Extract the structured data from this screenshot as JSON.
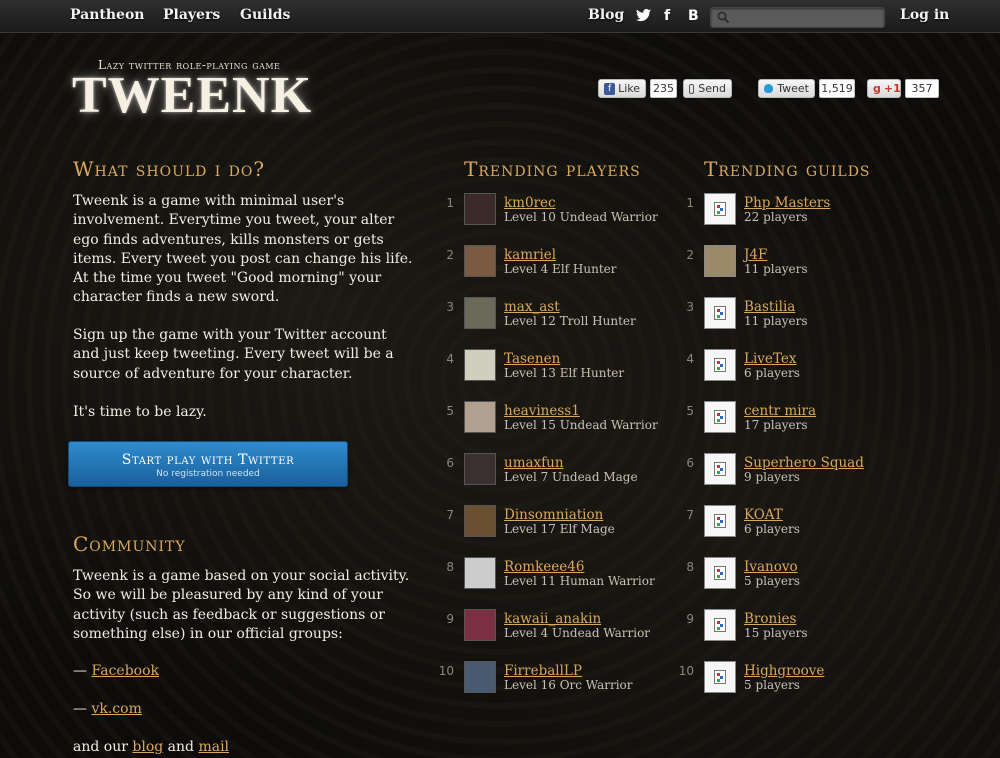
{
  "nav": {
    "pantheon": "Pantheon",
    "players": "Players",
    "guilds": "Guilds",
    "blog": "Blog",
    "login": "Log in",
    "search_placeholder": ""
  },
  "brand": {
    "tagline": "Lazy twitter role-playing game",
    "logo": "TWEENK"
  },
  "share": {
    "like_label": "Like",
    "like_count": "235",
    "send_label": "Send",
    "tweet_label": "Tweet",
    "tweet_count": "1,519",
    "gplus_label": "+1",
    "gplus_count": "357"
  },
  "intro": {
    "heading": "What should i do?",
    "p1": "Tweenk is a game with minimal user's involvement. Everytime you tweet, your alter ego finds adventures, kills monsters or gets items. Every tweet you post can change his life. At the time you tweet \"Good morning\" your character finds a new sword.",
    "p2": "Sign up the game with your Twitter account and just keep tweeting. Every tweet will be a source of adventure for your character.",
    "p3": "It's time to be lazy.",
    "cta_main": "Start play with Twitter",
    "cta_sub": "No registration needed"
  },
  "community": {
    "heading": "Community",
    "p1": "Tweenk is a game based on your social activity. So we will be pleasured by any kind of your activity (such as feedback or suggestions or something else) in our official groups:",
    "dash": "—",
    "facebook": "Facebook",
    "vk": "vk.com",
    "and_our": "and our",
    "blog": "blog",
    "and": "and",
    "mail": "mail"
  },
  "players": {
    "heading": "Trending players",
    "items": [
      {
        "rank": "1",
        "name": "km0rec",
        "sub": "Level 10 Undead Warrior"
      },
      {
        "rank": "2",
        "name": "kamriel",
        "sub": "Level 4 Elf Hunter"
      },
      {
        "rank": "3",
        "name": "max_ast",
        "sub": "Level 12 Troll Hunter"
      },
      {
        "rank": "4",
        "name": "Tasenen",
        "sub": "Level 13 Elf Hunter"
      },
      {
        "rank": "5",
        "name": "heaviness1",
        "sub": "Level 15 Undead Warrior"
      },
      {
        "rank": "6",
        "name": "umaxfun",
        "sub": "Level 7 Undead Mage"
      },
      {
        "rank": "7",
        "name": "Dinsomniation",
        "sub": "Level 17 Elf Mage"
      },
      {
        "rank": "8",
        "name": "Romkeee46",
        "sub": "Level 11 Human Warrior"
      },
      {
        "rank": "9",
        "name": "kawaii_anakin",
        "sub": "Level 4 Undead Warrior"
      },
      {
        "rank": "10",
        "name": "FirreballLP",
        "sub": "Level 16 Orc Warrior"
      }
    ]
  },
  "guilds": {
    "heading": "Trending guilds",
    "items": [
      {
        "rank": "1",
        "name": "Php Masters",
        "sub": "22 players"
      },
      {
        "rank": "2",
        "name": "J4F",
        "sub": "11 players"
      },
      {
        "rank": "3",
        "name": "Bastilia",
        "sub": "11 players"
      },
      {
        "rank": "4",
        "name": "LiveTex",
        "sub": "6 players"
      },
      {
        "rank": "5",
        "name": "centr mira",
        "sub": "17 players"
      },
      {
        "rank": "6",
        "name": "Superhero Squad",
        "sub": "9 players"
      },
      {
        "rank": "7",
        "name": "KOAT",
        "sub": "6 players"
      },
      {
        "rank": "8",
        "name": "Ivanovo",
        "sub": "5 players"
      },
      {
        "rank": "9",
        "name": "Bronies",
        "sub": "15 players"
      },
      {
        "rank": "10",
        "name": "Highgroove",
        "sub": "5 players"
      }
    ]
  }
}
